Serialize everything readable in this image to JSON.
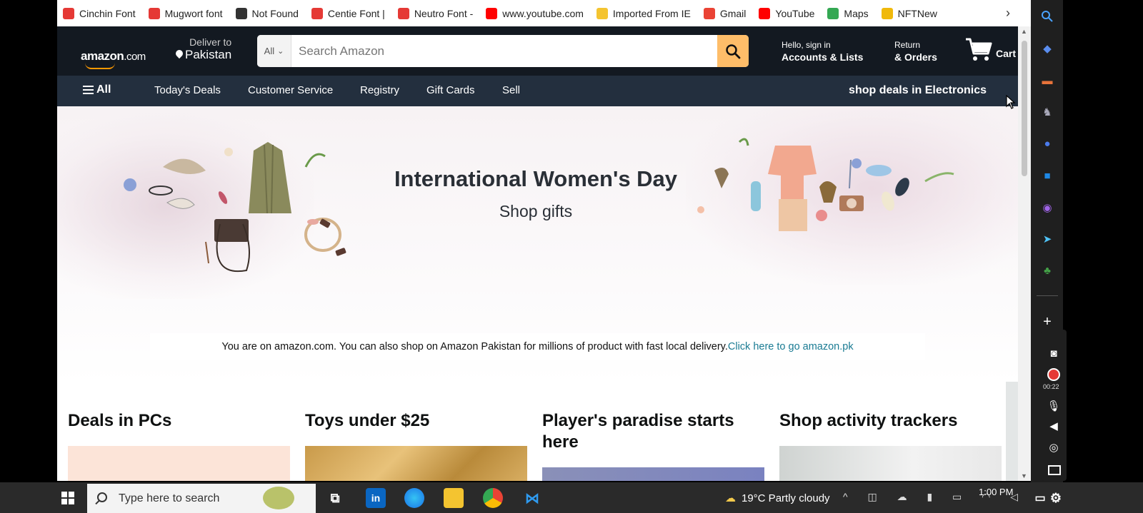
{
  "bookmarks": [
    {
      "label": "Cinchin Font",
      "icon": "dafont-icon",
      "color": "#e53935"
    },
    {
      "label": "Mugwort font",
      "icon": "dafont-icon",
      "color": "#e53935"
    },
    {
      "label": "Not Found",
      "icon": "slash-icon",
      "color": "#333333"
    },
    {
      "label": "Centie Font |",
      "icon": "dafont-icon",
      "color": "#e53935"
    },
    {
      "label": "Neutro Font -",
      "icon": "d-circle-icon",
      "color": "#e53935"
    },
    {
      "label": "www.youtube.com",
      "icon": "youtube-icon",
      "color": "#ff0000"
    },
    {
      "label": "Imported From IE",
      "icon": "folder-icon",
      "color": "#f4c430"
    },
    {
      "label": "Gmail",
      "icon": "gmail-icon",
      "color": "#ea4335"
    },
    {
      "label": "YouTube",
      "icon": "youtube-icon",
      "color": "#ff0000"
    },
    {
      "label": "Maps",
      "icon": "maps-icon",
      "color": "#34a853"
    },
    {
      "label": "NFTNew",
      "icon": "binance-icon",
      "color": "#f0b90b"
    }
  ],
  "header": {
    "logo": "amazon",
    "logo_suffix": ".com",
    "deliver_line1": "Deliver to",
    "deliver_line2": "Pakistan",
    "search_category": "All",
    "search_placeholder": "Search Amazon",
    "account_line1": "Hello, sign in",
    "account_line2": "Accounts & Lists",
    "orders_line1": "Return",
    "orders_line2": "& Orders",
    "cart_label": "Cart"
  },
  "subnav": {
    "all_label": "All",
    "items": [
      "Today's Deals",
      "Customer Service",
      "Registry",
      "Gift Cards",
      "Sell"
    ],
    "promo": "shop deals in Electronics"
  },
  "hero": {
    "title": "International Women's Day",
    "subtitle": "Shop gifts"
  },
  "notice": {
    "text": "You are on amazon.com. You can also shop on Amazon Pakistan for millions of product with fast local delivery.",
    "link": "Click here to go amazon.pk"
  },
  "cards": [
    {
      "title": "Deals in PCs"
    },
    {
      "title": "Toys under $25"
    },
    {
      "title": "Player's paradise starts here"
    },
    {
      "title": "Shop activity trackers"
    }
  ],
  "recorder": {
    "time": "00:22"
  },
  "taskbar": {
    "search_placeholder": "Type here to search",
    "weather": "19°C  Partly cloudy",
    "time": "1:00 PM"
  },
  "colors": {
    "amazon_dark": "#131921",
    "amazon_nav": "#232f3e",
    "amazon_orange": "#ff9900",
    "search_button": "#febd69",
    "link": "#1a7b93"
  }
}
